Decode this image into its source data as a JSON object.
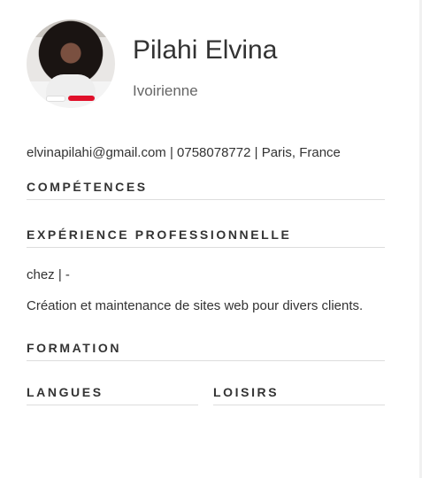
{
  "header": {
    "name": "Pilahi Elvina",
    "nationality": "Ivoirienne"
  },
  "contact": {
    "email": "elvinapilahi@gmail.com",
    "sep1": " | ",
    "phone": "0758078772",
    "sep2": " | ",
    "location": "Paris, France"
  },
  "sections": {
    "skills": "COMPÉTENCES",
    "experience": "EXPÉRIENCE PROFESSIONNELLE",
    "education": "FORMATION",
    "languages": "LANGUES",
    "hobbies": "LOISIRS"
  },
  "experience": {
    "line": "chez | -",
    "description": "Création et maintenance de sites web pour divers clients."
  }
}
